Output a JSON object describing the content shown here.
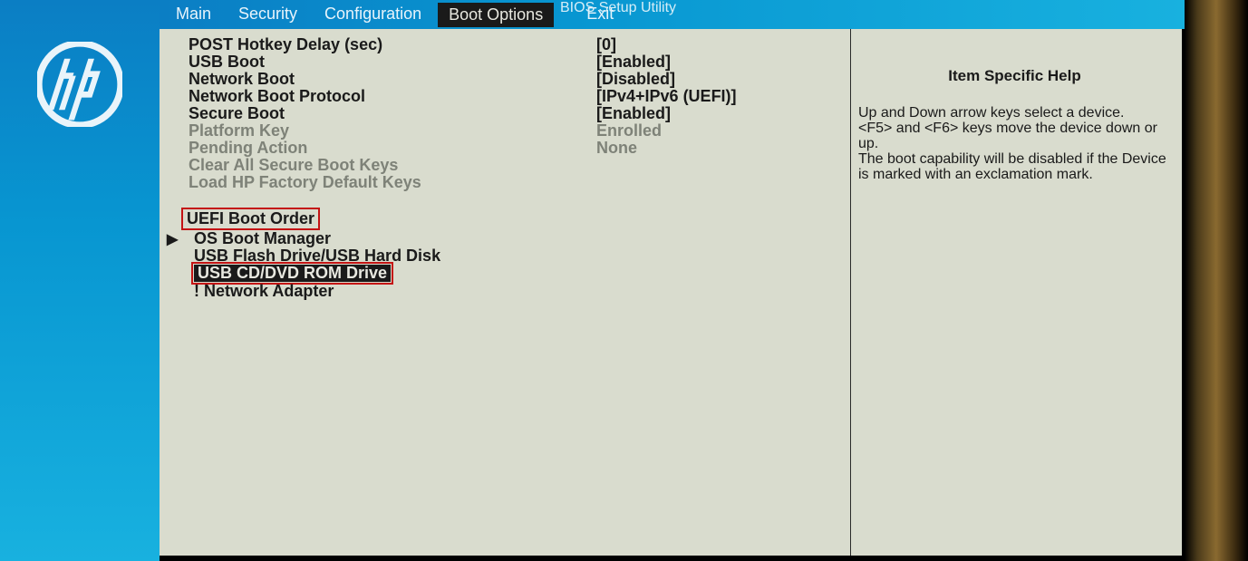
{
  "bios_title": "BIOS Setup Utility",
  "tabs": {
    "main": "Main",
    "security": "Security",
    "configuration": "Configuration",
    "boot_options": "Boot Options",
    "exit": "Exit"
  },
  "settings": [
    {
      "label": "POST Hotkey Delay (sec)",
      "value": "[0]",
      "disabled": false
    },
    {
      "label": "USB Boot",
      "value": "[Enabled]",
      "disabled": false
    },
    {
      "label": "Network Boot",
      "value": "[Disabled]",
      "disabled": false
    },
    {
      "label": "Network Boot Protocol",
      "value": "[IPv4+IPv6 (UEFI)]",
      "disabled": false
    },
    {
      "label": "Secure Boot",
      "value": "[Enabled]",
      "disabled": false
    },
    {
      "label": "Platform Key",
      "value": "Enrolled",
      "disabled": true
    },
    {
      "label": "Pending Action",
      "value": "None",
      "disabled": true
    },
    {
      "label": "Clear All Secure Boot Keys",
      "value": "",
      "disabled": true
    },
    {
      "label": "Load HP Factory Default Keys",
      "value": "",
      "disabled": true
    }
  ],
  "boot_order": {
    "header": "UEFI Boot Order",
    "items": [
      {
        "label": "OS Boot Manager",
        "arrow": true,
        "selected": false,
        "warn": false
      },
      {
        "label": "USB Flash Drive/USB Hard Disk",
        "arrow": false,
        "selected": false,
        "warn": false
      },
      {
        "label": "USB CD/DVD ROM Drive",
        "arrow": false,
        "selected": true,
        "warn": false
      },
      {
        "label": "! Network Adapter",
        "arrow": false,
        "selected": false,
        "warn": true
      }
    ]
  },
  "help": {
    "title": "Item Specific Help",
    "body": "Up and Down arrow keys select a device.\n<F5> and <F6> keys move the device down or up.\nThe boot capability will be disabled if the Device is marked with an exclamation mark."
  }
}
